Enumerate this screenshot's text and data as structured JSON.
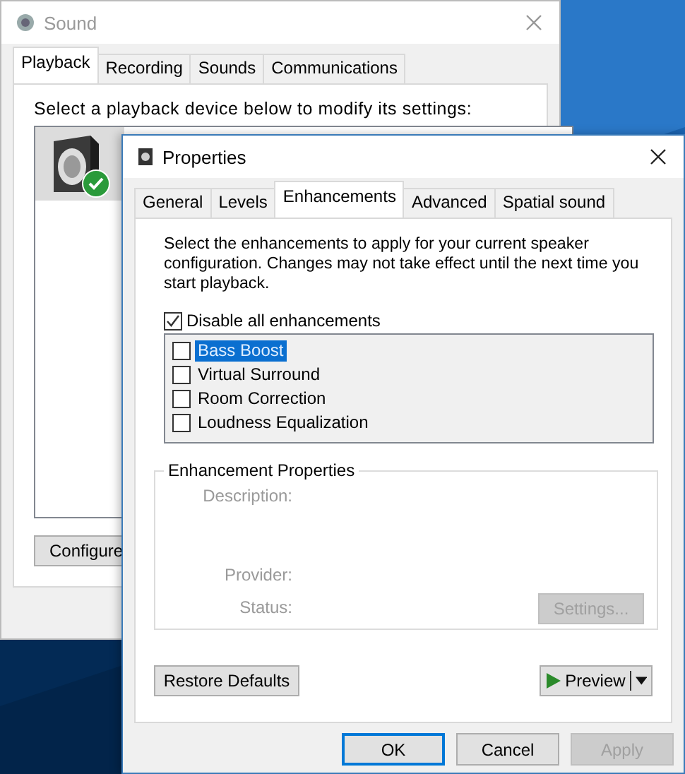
{
  "sound_window": {
    "title": "Sound",
    "tabs": [
      {
        "label": "Playback",
        "selected": true
      },
      {
        "label": "Recording",
        "selected": false
      },
      {
        "label": "Sounds",
        "selected": false
      },
      {
        "label": "Communications",
        "selected": false
      }
    ],
    "prompt": "Select a playback device below to modify its settings:",
    "devices": [
      {
        "is_default": true,
        "selected": true
      }
    ],
    "configure_button": {
      "label": "Configure"
    }
  },
  "properties_window": {
    "title": "Properties",
    "tabs": [
      {
        "label": "General",
        "selected": false
      },
      {
        "label": "Levels",
        "selected": false
      },
      {
        "label": "Enhancements",
        "selected": true
      },
      {
        "label": "Advanced",
        "selected": false
      },
      {
        "label": "Spatial sound",
        "selected": false
      }
    ],
    "description": "Select the enhancements to apply for your current speaker configuration. Changes may not take effect until the next time you start playback.",
    "disable_all": {
      "label": "Disable all enhancements",
      "checked": true
    },
    "enhancements": [
      {
        "label": "Bass Boost",
        "checked": false,
        "selected": true
      },
      {
        "label": "Virtual Surround",
        "checked": false,
        "selected": false
      },
      {
        "label": "Room Correction",
        "checked": false,
        "selected": false
      },
      {
        "label": "Loudness Equalization",
        "checked": false,
        "selected": false
      }
    ],
    "properties_group": {
      "title": "Enhancement Properties",
      "fields": [
        {
          "label": "Description:"
        },
        {
          "label": "Provider:"
        },
        {
          "label": "Status:"
        }
      ],
      "settings_button": {
        "label": "Settings...",
        "disabled": true
      }
    },
    "restore_button": {
      "label": "Restore Defaults"
    },
    "preview_button": {
      "label": "Preview"
    },
    "dialog_buttons": [
      {
        "label": "OK",
        "focused": true,
        "disabled": false
      },
      {
        "label": "Cancel",
        "focused": false,
        "disabled": false
      },
      {
        "label": "Apply",
        "focused": false,
        "disabled": true
      }
    ]
  }
}
